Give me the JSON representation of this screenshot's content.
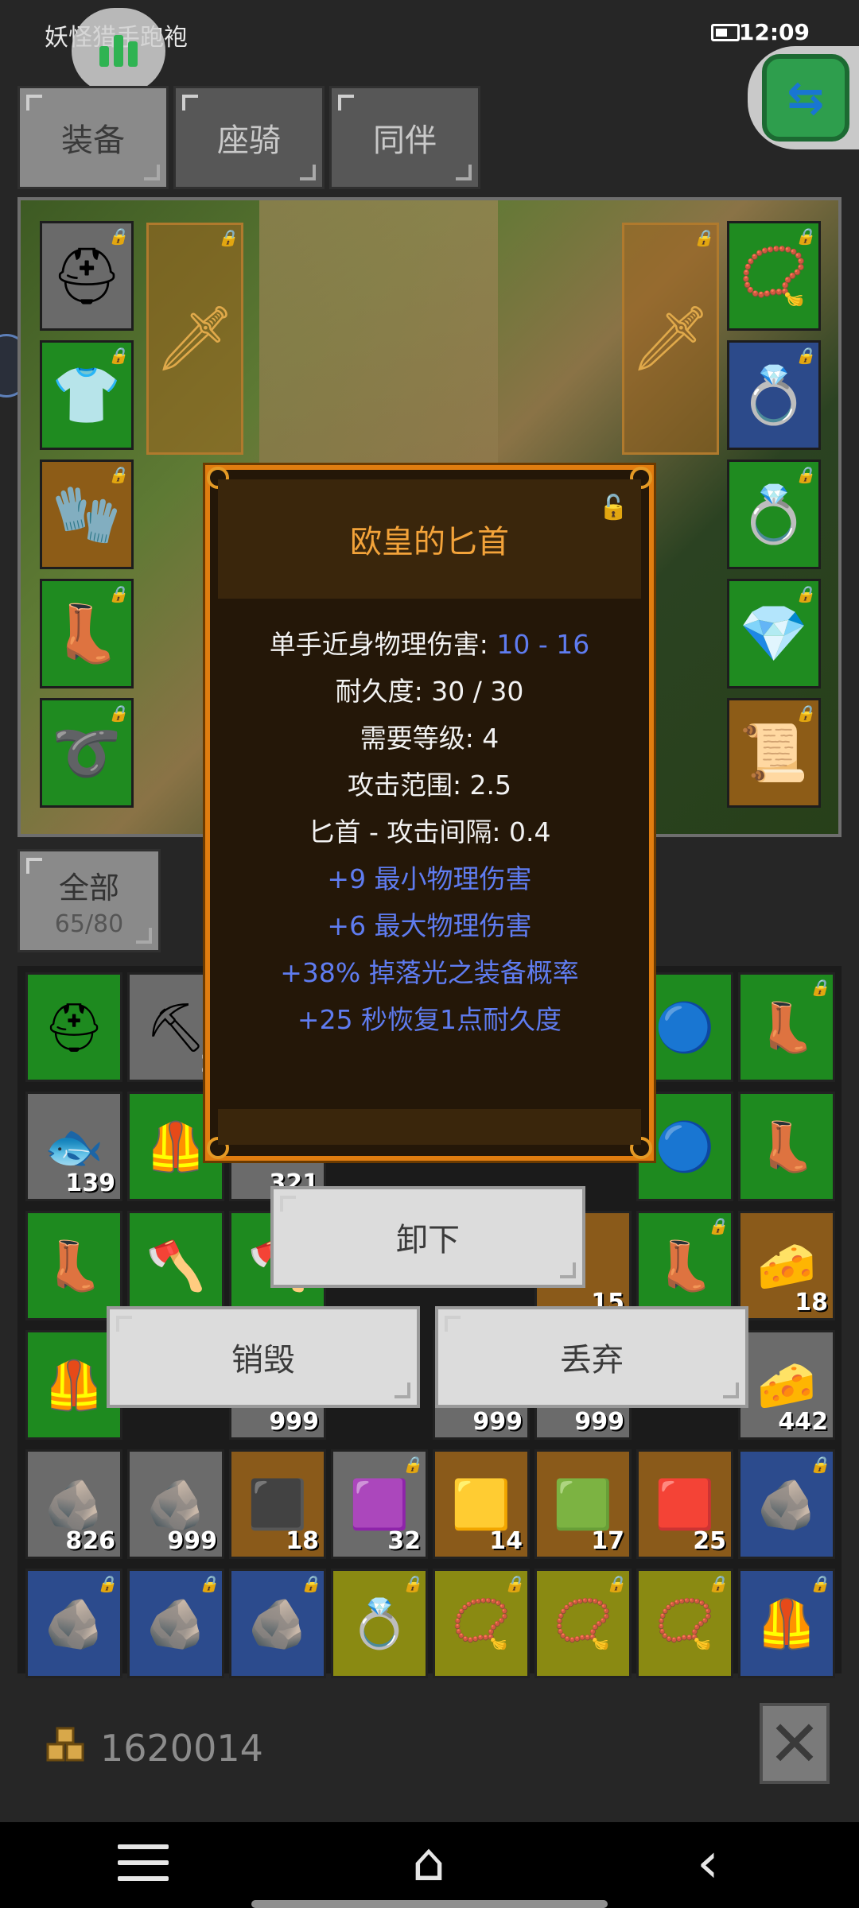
{
  "status_bar": {
    "app_name": "妖怪猎手跑袍",
    "time": "12:09"
  },
  "tabs": [
    {
      "label": "装备",
      "active": true
    },
    {
      "label": "座骑",
      "active": false
    },
    {
      "label": "同伴",
      "active": false
    }
  ],
  "filter": {
    "label": "全部",
    "count": "65/80"
  },
  "tooltip": {
    "title": "欧皇的匕首",
    "stats": [
      {
        "label": "单手近身物理伤害: ",
        "value": "10 - 16"
      },
      {
        "text": "耐久度: 30 / 30"
      },
      {
        "text": "需要等级: 4"
      },
      {
        "text": "攻击范围: 2.5"
      },
      {
        "text": "匕首 - 攻击间隔: 0.4"
      }
    ],
    "affixes": [
      "+9 最小物理伤害",
      "+6 最大物理伤害",
      "+38% 掉落光之装备概率",
      "+25 秒恢复1点耐久度"
    ]
  },
  "buttons": {
    "unequip": "卸下",
    "destroy": "销毁",
    "discard": "丢弃"
  },
  "inventory_quantities": [
    "2",
    "139",
    "321",
    "15",
    "18",
    "999",
    "999",
    "999",
    "442",
    "826",
    "999",
    "18",
    "32",
    "14",
    "17",
    "25"
  ],
  "gold": "1620014",
  "colors": {
    "accent": "#e07d10",
    "title": "#f3a33a",
    "affix": "#5f7cf0"
  }
}
